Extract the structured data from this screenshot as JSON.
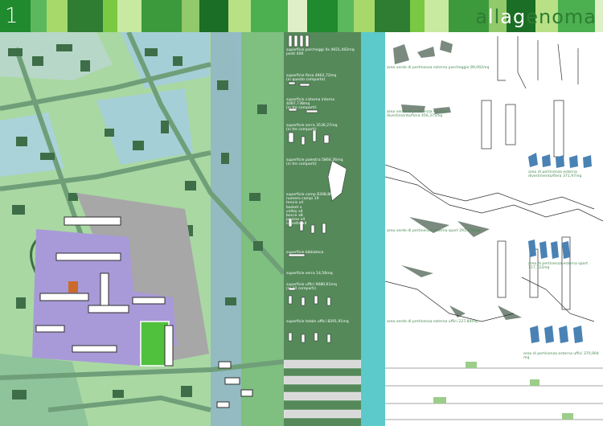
{
  "header": {
    "page_number": "1",
    "title_letters": [
      "a",
      "l",
      "l",
      "a",
      "g",
      "e",
      "n",
      "o",
      "m",
      "a"
    ],
    "title_colors": [
      "#2e7d32",
      "#ffffff",
      "#2e7d32",
      "#ffffff",
      "#ffffff",
      "#2e7d32",
      "#2e7d32",
      "#2e7d32",
      "#2e7d32",
      "#2e7d32"
    ],
    "stripe_colors": [
      "#1f8a2e",
      "#5cb85c",
      "#a6d96a",
      "#2e7d32",
      "#7ac943",
      "#c7e9a0",
      "#3c9a3c",
      "#92c96b",
      "#1b6e25",
      "#b8e186",
      "#4caf50",
      "#dff0c6"
    ]
  },
  "colors": {
    "map_base": "#9ed19a",
    "map_light": "#b9dcbe",
    "water_blue": "#a9d2d9",
    "building_dark": "#3e6e47",
    "road": "#6f9f79",
    "project_purple": "#a89ad8",
    "project_white": "#ffffff",
    "site_gray": "#a7a7a7",
    "field_green": "#4fc13d",
    "strip_blue": "#8fb6c7",
    "panel_dark": "#55895a",
    "panel_cyan": "#5cc9cb",
    "diagram_blue": "#4a82b4",
    "diagram_gray": "#7a8a7e"
  },
  "labels_left": [
    "superficie parcheggi 4x 4921,402mq\nposti 400",
    "superficie fiera 4802,72mq\n(in questo comparto)",
    "superficie cisterna interna 4087,738mq\n(in tre comparti)",
    "superficie serra 3536,27mq\n(in tre comparti)",
    "superficie palestra 5864,26mq\n(in tre comparti)",
    "superficie comp 8308,86mq\nnumero campi 19\ntennis x4\nbasket x\nvolley x4\nbocce x8\npiscine x4\ncalcetto x4",
    "superficie biblioteca",
    "superficie serra 14,56mq",
    "superficie uffici 9680,61mq\n(in 10 comparti)",
    "superficie totale uffici 8291,91mq"
  ],
  "labels_right": [
    "area verde di pertinenza esterna parcheggio 89,092mq",
    "area verde di pertinenza esterna\ndivertimento/fiera 456,375mq",
    "area di pertinenza esterna divertimento/fiera 371,97mq",
    "area verde di pertinenza esterna sport 291,179mq",
    "area di pertinenza esterna sport 117,722mq",
    "area verde di pertinenza esterna uffici 227,84mq",
    "area di pertinenza esterna uffici 370,904 mq"
  ]
}
